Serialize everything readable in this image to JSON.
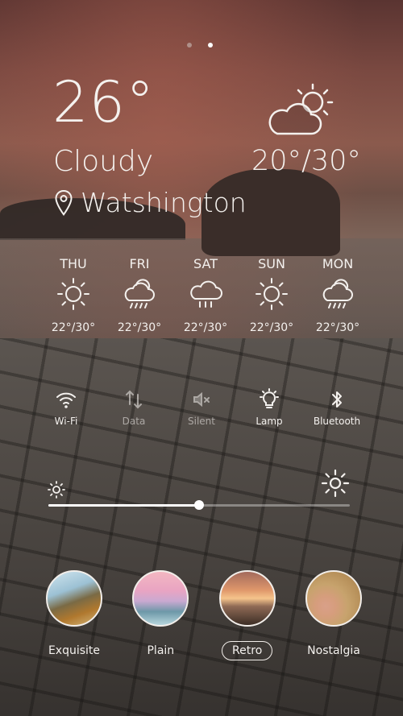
{
  "pager": {
    "count": 2,
    "active": 1
  },
  "current": {
    "temperature": "26°",
    "condition": "Cloudy",
    "location": "Watshington",
    "range": "20°/30°",
    "icon": "sun-behind-cloud-icon"
  },
  "forecast": [
    {
      "day": "THU",
      "icon": "sun-icon",
      "range": "22°/30°"
    },
    {
      "day": "FRI",
      "icon": "cloud-rain-icon",
      "range": "22°/30°"
    },
    {
      "day": "SAT",
      "icon": "cloud-rain-icon",
      "range": "22°/30°"
    },
    {
      "day": "SUN",
      "icon": "sun-icon",
      "range": "22°/30°"
    },
    {
      "day": "MON",
      "icon": "cloud-rain-icon",
      "range": "22°/30°"
    }
  ],
  "toggles": [
    {
      "label": "Wi-Fi",
      "icon": "wifi-icon",
      "state": "on"
    },
    {
      "label": "Data",
      "icon": "data-arrows-icon",
      "state": "off"
    },
    {
      "label": "Silent",
      "icon": "speaker-mute-icon",
      "state": "off"
    },
    {
      "label": "Lamp",
      "icon": "lightbulb-icon",
      "state": "on"
    },
    {
      "label": "Bluetooth",
      "icon": "bluetooth-icon",
      "state": "on"
    }
  ],
  "brightness": {
    "level": 0.5
  },
  "themes": [
    {
      "name": "Exquisite",
      "selected": false
    },
    {
      "name": "Plain",
      "selected": false
    },
    {
      "name": "Retro",
      "selected": true
    },
    {
      "name": "Nostalgia",
      "selected": false
    }
  ]
}
